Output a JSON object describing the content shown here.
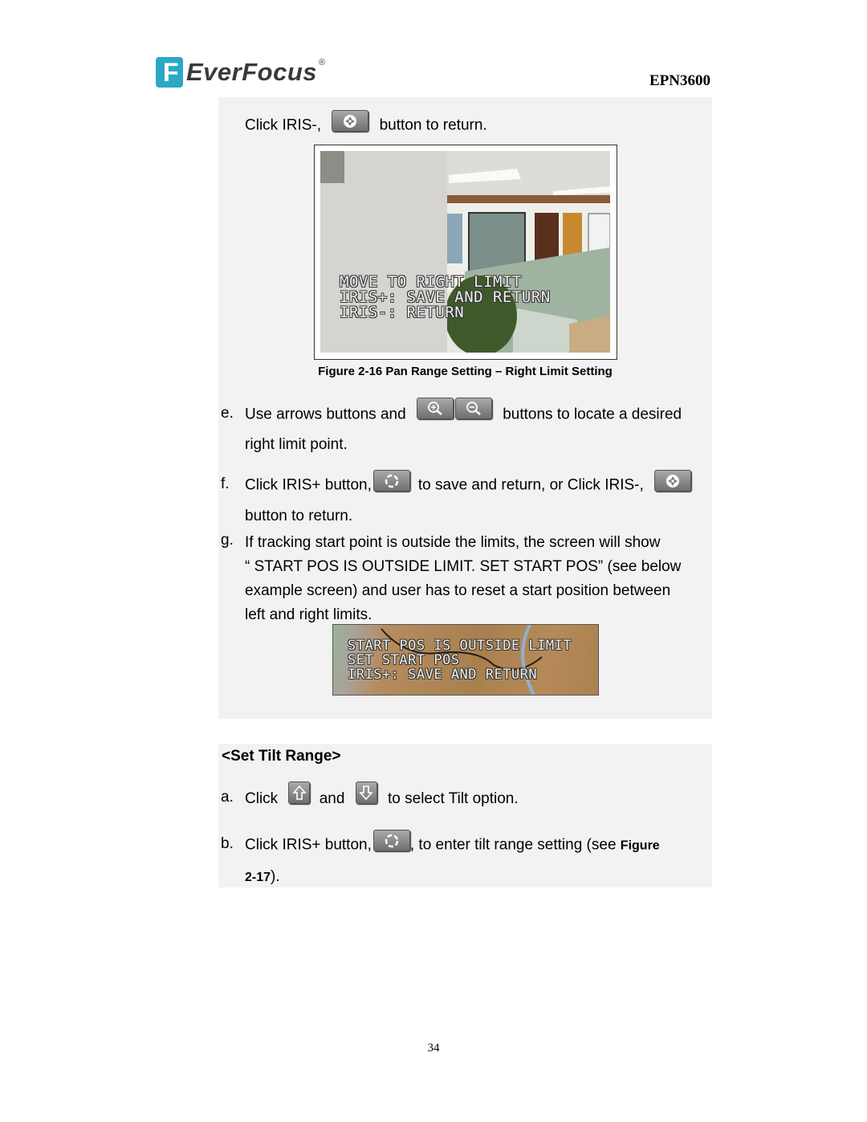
{
  "header": {
    "brand": "EverFocus",
    "brand_mark": "F",
    "registered": "®",
    "model": "EPN3600",
    "brand_color": "#2aa8c6"
  },
  "section1": {
    "intro": {
      "before": "Click IRIS-,",
      "icon": "iris-minus-button",
      "after": "button to return."
    },
    "figure16": {
      "osd_lines": [
        "MOVE TO RIGHT LIMIT",
        "IRIS+: SAVE AND RETURN",
        "IRIS-: RETURN"
      ],
      "caption": "Figure 2-16 Pan Range Setting – Right Limit Setting"
    },
    "steps": [
      {
        "marker": "e.",
        "line1_before": "Use arrows buttons and",
        "icons": [
          "zoom-in-button",
          "zoom-out-button"
        ],
        "line1_after": "buttons to locate a desired",
        "line2": "right limit point."
      },
      {
        "marker": "f.",
        "line1_before": "Click IRIS+ button,",
        "icon1": "iris-plus-button",
        "line1_middle": "to save and return, or Click IRIS-,",
        "icon2": "iris-minus-button",
        "line2": "button to return."
      },
      {
        "marker": "g.",
        "lines": [
          "If tracking start point is outside the limits, the screen will show",
          "“ START POS IS OUTSIDE LIMIT. SET START POS” (see below",
          "example screen) and user has to reset a start position between",
          "left and right limits."
        ]
      }
    ],
    "example_osd_lines": [
      "START POS IS OUTSIDE LIMIT",
      "SET START POS",
      "IRIS+: SAVE AND RETURN"
    ]
  },
  "section2": {
    "heading": "<Set Tilt Range>",
    "steps": [
      {
        "marker": "a.",
        "before": "Click",
        "icon1": "tilt-up-button",
        "middle": "and",
        "icon2": "tilt-down-button",
        "after": "to select Tilt option."
      },
      {
        "marker": "b.",
        "before": "Click IRIS+ button,",
        "icon": "iris-plus-button",
        "after": ", to enter tilt range setting (see",
        "ref_bold_a": "Figure",
        "ref_bold_b": "2-17",
        "ref_end": ")."
      }
    ]
  },
  "footer": {
    "page_number": "34"
  }
}
